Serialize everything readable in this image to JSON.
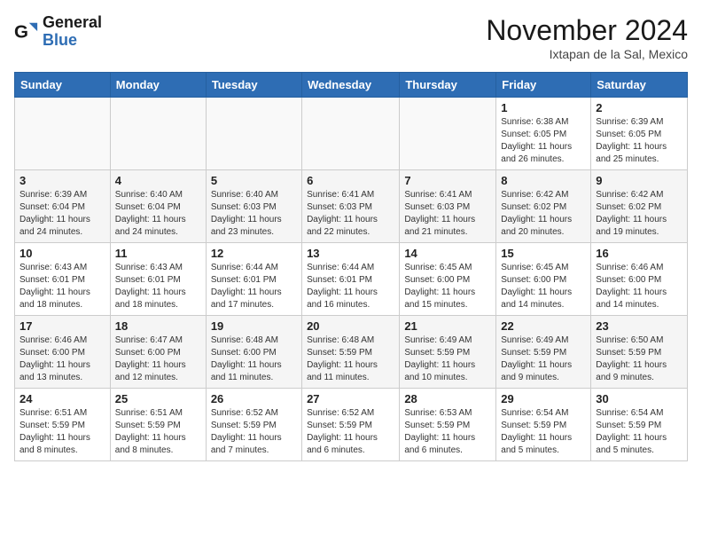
{
  "logo": {
    "line1": "General",
    "line2": "Blue"
  },
  "title": "November 2024",
  "location": "Ixtapan de la Sal, Mexico",
  "days_of_week": [
    "Sunday",
    "Monday",
    "Tuesday",
    "Wednesday",
    "Thursday",
    "Friday",
    "Saturday"
  ],
  "weeks": [
    [
      {
        "day": "",
        "info": ""
      },
      {
        "day": "",
        "info": ""
      },
      {
        "day": "",
        "info": ""
      },
      {
        "day": "",
        "info": ""
      },
      {
        "day": "",
        "info": ""
      },
      {
        "day": "1",
        "info": "Sunrise: 6:38 AM\nSunset: 6:05 PM\nDaylight: 11 hours and 26 minutes."
      },
      {
        "day": "2",
        "info": "Sunrise: 6:39 AM\nSunset: 6:05 PM\nDaylight: 11 hours and 25 minutes."
      }
    ],
    [
      {
        "day": "3",
        "info": "Sunrise: 6:39 AM\nSunset: 6:04 PM\nDaylight: 11 hours and 24 minutes."
      },
      {
        "day": "4",
        "info": "Sunrise: 6:40 AM\nSunset: 6:04 PM\nDaylight: 11 hours and 24 minutes."
      },
      {
        "day": "5",
        "info": "Sunrise: 6:40 AM\nSunset: 6:03 PM\nDaylight: 11 hours and 23 minutes."
      },
      {
        "day": "6",
        "info": "Sunrise: 6:41 AM\nSunset: 6:03 PM\nDaylight: 11 hours and 22 minutes."
      },
      {
        "day": "7",
        "info": "Sunrise: 6:41 AM\nSunset: 6:03 PM\nDaylight: 11 hours and 21 minutes."
      },
      {
        "day": "8",
        "info": "Sunrise: 6:42 AM\nSunset: 6:02 PM\nDaylight: 11 hours and 20 minutes."
      },
      {
        "day": "9",
        "info": "Sunrise: 6:42 AM\nSunset: 6:02 PM\nDaylight: 11 hours and 19 minutes."
      }
    ],
    [
      {
        "day": "10",
        "info": "Sunrise: 6:43 AM\nSunset: 6:01 PM\nDaylight: 11 hours and 18 minutes."
      },
      {
        "day": "11",
        "info": "Sunrise: 6:43 AM\nSunset: 6:01 PM\nDaylight: 11 hours and 18 minutes."
      },
      {
        "day": "12",
        "info": "Sunrise: 6:44 AM\nSunset: 6:01 PM\nDaylight: 11 hours and 17 minutes."
      },
      {
        "day": "13",
        "info": "Sunrise: 6:44 AM\nSunset: 6:01 PM\nDaylight: 11 hours and 16 minutes."
      },
      {
        "day": "14",
        "info": "Sunrise: 6:45 AM\nSunset: 6:00 PM\nDaylight: 11 hours and 15 minutes."
      },
      {
        "day": "15",
        "info": "Sunrise: 6:45 AM\nSunset: 6:00 PM\nDaylight: 11 hours and 14 minutes."
      },
      {
        "day": "16",
        "info": "Sunrise: 6:46 AM\nSunset: 6:00 PM\nDaylight: 11 hours and 14 minutes."
      }
    ],
    [
      {
        "day": "17",
        "info": "Sunrise: 6:46 AM\nSunset: 6:00 PM\nDaylight: 11 hours and 13 minutes."
      },
      {
        "day": "18",
        "info": "Sunrise: 6:47 AM\nSunset: 6:00 PM\nDaylight: 11 hours and 12 minutes."
      },
      {
        "day": "19",
        "info": "Sunrise: 6:48 AM\nSunset: 6:00 PM\nDaylight: 11 hours and 11 minutes."
      },
      {
        "day": "20",
        "info": "Sunrise: 6:48 AM\nSunset: 5:59 PM\nDaylight: 11 hours and 11 minutes."
      },
      {
        "day": "21",
        "info": "Sunrise: 6:49 AM\nSunset: 5:59 PM\nDaylight: 11 hours and 10 minutes."
      },
      {
        "day": "22",
        "info": "Sunrise: 6:49 AM\nSunset: 5:59 PM\nDaylight: 11 hours and 9 minutes."
      },
      {
        "day": "23",
        "info": "Sunrise: 6:50 AM\nSunset: 5:59 PM\nDaylight: 11 hours and 9 minutes."
      }
    ],
    [
      {
        "day": "24",
        "info": "Sunrise: 6:51 AM\nSunset: 5:59 PM\nDaylight: 11 hours and 8 minutes."
      },
      {
        "day": "25",
        "info": "Sunrise: 6:51 AM\nSunset: 5:59 PM\nDaylight: 11 hours and 8 minutes."
      },
      {
        "day": "26",
        "info": "Sunrise: 6:52 AM\nSunset: 5:59 PM\nDaylight: 11 hours and 7 minutes."
      },
      {
        "day": "27",
        "info": "Sunrise: 6:52 AM\nSunset: 5:59 PM\nDaylight: 11 hours and 6 minutes."
      },
      {
        "day": "28",
        "info": "Sunrise: 6:53 AM\nSunset: 5:59 PM\nDaylight: 11 hours and 6 minutes."
      },
      {
        "day": "29",
        "info": "Sunrise: 6:54 AM\nSunset: 5:59 PM\nDaylight: 11 hours and 5 minutes."
      },
      {
        "day": "30",
        "info": "Sunrise: 6:54 AM\nSunset: 5:59 PM\nDaylight: 11 hours and 5 minutes."
      }
    ]
  ]
}
